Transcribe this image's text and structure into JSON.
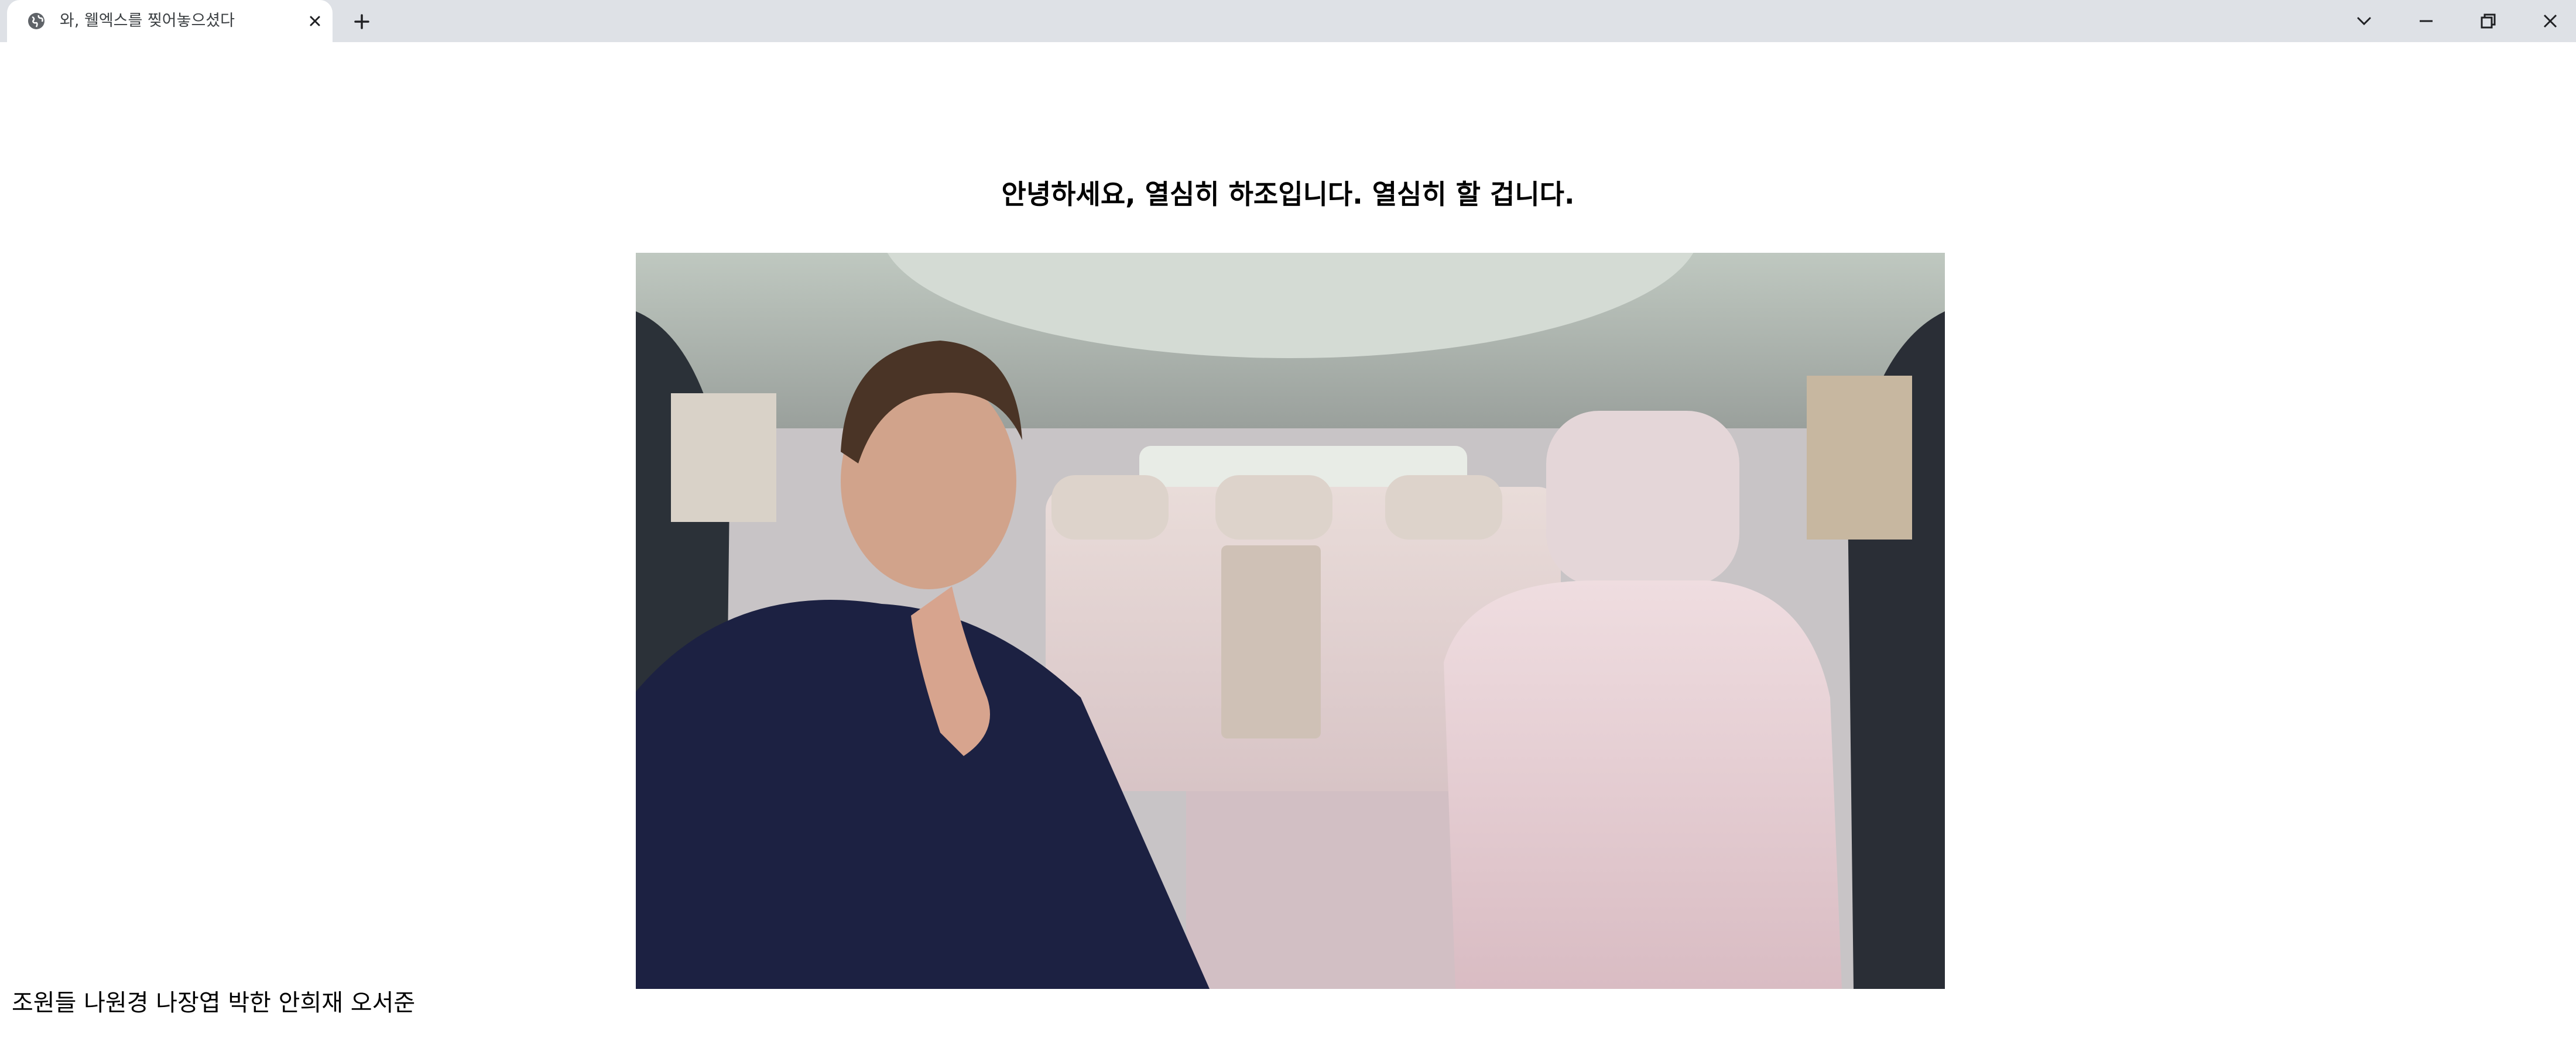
{
  "browser": {
    "tab_title": "와, 웰엑스를 찢어놓으셨다",
    "tab_icon": "globe-icon",
    "new_tab_icon": "plus-icon",
    "close_tab_icon": "close-icon",
    "window_controls": [
      "chevron-down-icon",
      "minimize-icon",
      "restore-icon",
      "close-icon"
    ]
  },
  "page": {
    "heading": "안녕하세요, 열심히 하조입니다. 열심히 할 겁니다.",
    "media": {
      "type": "video",
      "description_icon": "car-interior-video"
    },
    "footer": "조원들 나원경 나장엽 박한 안희재 오서준"
  },
  "colors": {
    "titlebar_bg": "#dee1e6",
    "tab_bg": "#ffffff",
    "text": "#000000"
  }
}
